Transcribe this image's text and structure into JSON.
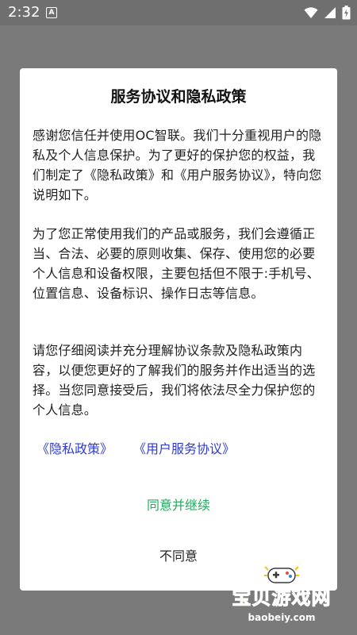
{
  "status_bar": {
    "time": "2:32",
    "notification_letter": "A",
    "icons": [
      "wifi-icon",
      "signal-icon",
      "battery-icon"
    ]
  },
  "dialog": {
    "title": "服务协议和隐私政策",
    "paragraphs": [
      "感谢您信任并使用OC智联。我们十分重视用户的隐私及个人信息保护。为了更好的保护您的权益，我们制定了《隐私政策》和《用户服务协议》，特向您说明如下。",
      "为了您正常使用我们的产品或服务，我们会遵循正当、合法、必要的原则收集、保存、使用您的必要个人信息和设备权限，主要包括但不限于:手机号、位置信息、设备标识、操作日志等信息。",
      "请您仔细阅读并充分理解协议条款及隐私政策内容，以便您更好的了解我们的服务并作出适当的选择。当您同意接受后，我们将依法尽全力保护您的个人信息。"
    ],
    "privacy_link": "《隐私政策》",
    "service_link": "《用户服务协议》",
    "agree_label": "同意并继续",
    "disagree_label": "不同意"
  },
  "watermark": {
    "text": "宝贝游戏网",
    "url": "baobeiy.com"
  },
  "colors": {
    "link": "#2f3bd1",
    "agree": "#2aa861",
    "watermark": "#f4c21a"
  }
}
